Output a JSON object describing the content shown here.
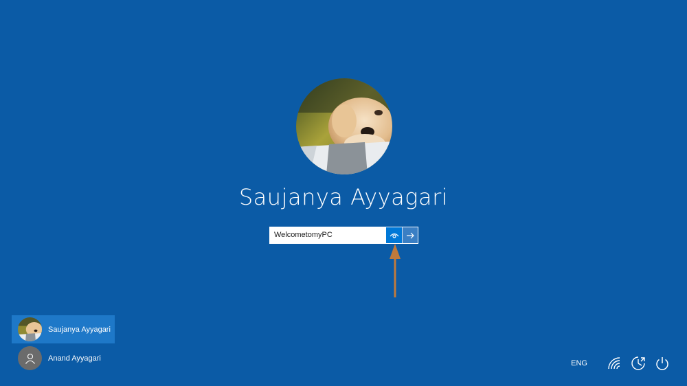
{
  "login": {
    "user_name": "Saujanya Ayyagari",
    "password_value": "WelcometomyPC",
    "reveal_icon": "eye-icon",
    "submit_icon": "arrow-right-icon"
  },
  "users": [
    {
      "name": "Saujanya Ayyagari",
      "selected": true,
      "avatar": "puppy-photo"
    },
    {
      "name": "Anand Ayyagari",
      "selected": false,
      "avatar": "generic-person-icon"
    }
  ],
  "tray": {
    "language": "ENG",
    "icons": [
      "wifi-icon",
      "ease-of-access-icon",
      "power-icon"
    ]
  },
  "colors": {
    "background": "#0b5ba6",
    "accent": "#0078d7",
    "annotation_arrow": "#c07a3c"
  }
}
